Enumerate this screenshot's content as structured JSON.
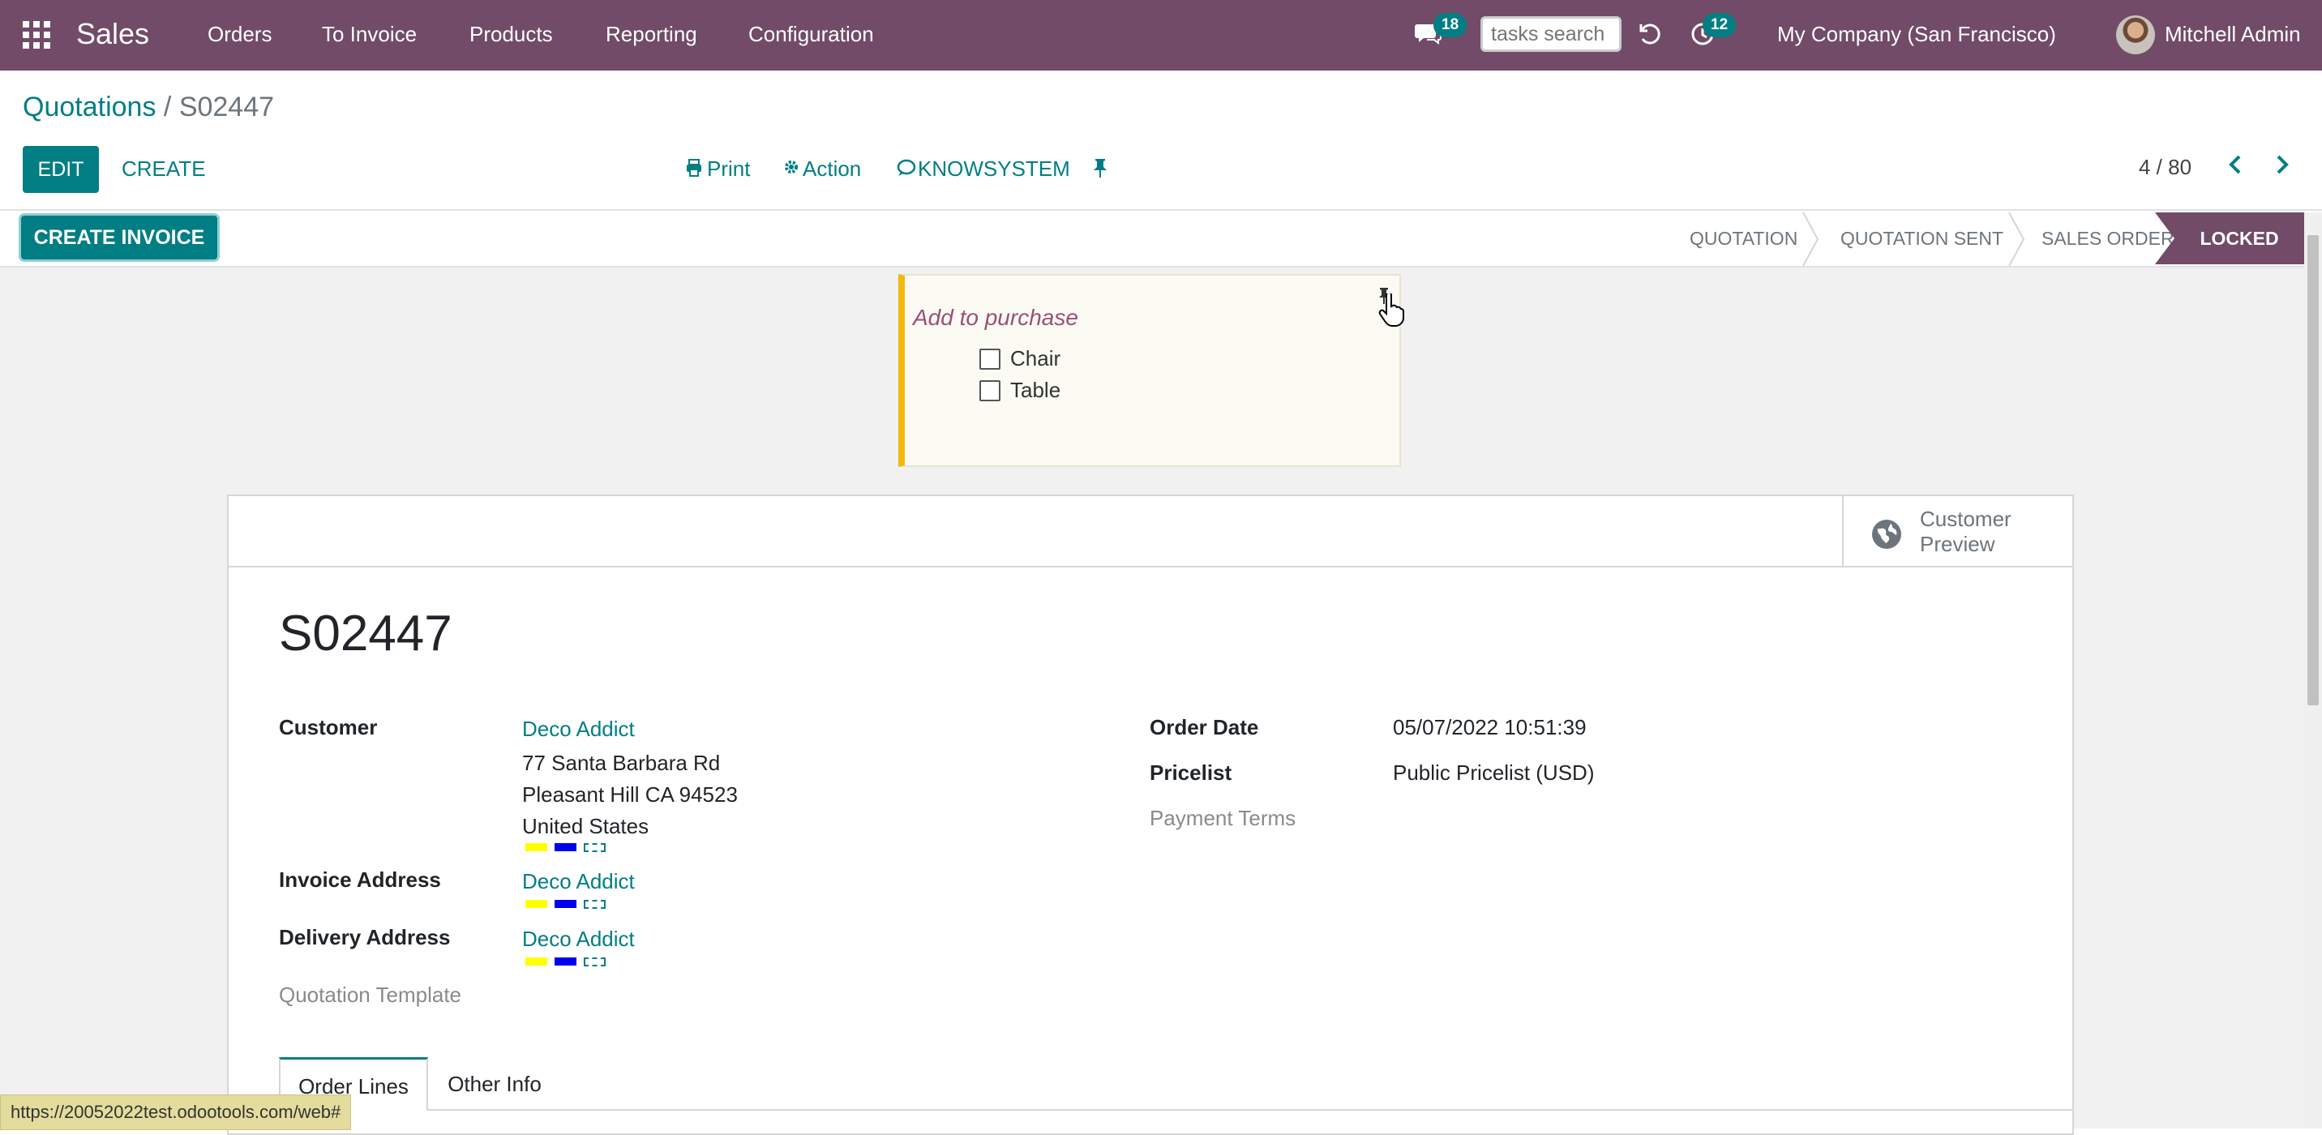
{
  "navbar": {
    "app_name": "Sales",
    "menu": [
      "Orders",
      "To Invoice",
      "Products",
      "Reporting",
      "Configuration"
    ],
    "messages_count": "18",
    "search_placeholder": "tasks search",
    "activities_count": "12",
    "company": "My Company (San Francisco)",
    "user": "Mitchell Admin"
  },
  "breadcrumb": {
    "parent": "Quotations",
    "separator": "/",
    "current": "S02447"
  },
  "toolbar": {
    "edit": "EDIT",
    "create": "CREATE",
    "print": "Print",
    "action": "Action",
    "knowsystem": "KNOWSYSTEM",
    "pager": "4 / 80"
  },
  "statusbar": {
    "create_invoice": "CREATE INVOICE",
    "stages": [
      "QUOTATION",
      "QUOTATION SENT",
      "SALES ORDER"
    ],
    "active_stage": "LOCKED"
  },
  "note": {
    "title": "Add to purchase",
    "items": [
      "Chair",
      "Table"
    ]
  },
  "sheet": {
    "smart_button": {
      "line1": "Customer",
      "line2": "Preview"
    },
    "name": "S02447",
    "customer_label": "Customer",
    "customer_name": "Deco Addict",
    "customer_address": [
      "77 Santa Barbara Rd",
      "Pleasant Hill CA 94523",
      "United States"
    ],
    "invoice_address_label": "Invoice Address",
    "invoice_address": "Deco Addict",
    "delivery_address_label": "Delivery Address",
    "delivery_address": "Deco Addict",
    "quotation_template_label": "Quotation Template",
    "order_date_label": "Order Date",
    "order_date": "05/07/2022 10:51:39",
    "pricelist_label": "Pricelist",
    "pricelist": "Public Pricelist (USD)",
    "payment_terms_label": "Payment Terms",
    "tag_colors": [
      "#ffff00",
      "#0000ee"
    ],
    "tabs": [
      "Order Lines",
      "Other Info"
    ]
  },
  "status_url": "https://20052022test.odootools.com/web#"
}
